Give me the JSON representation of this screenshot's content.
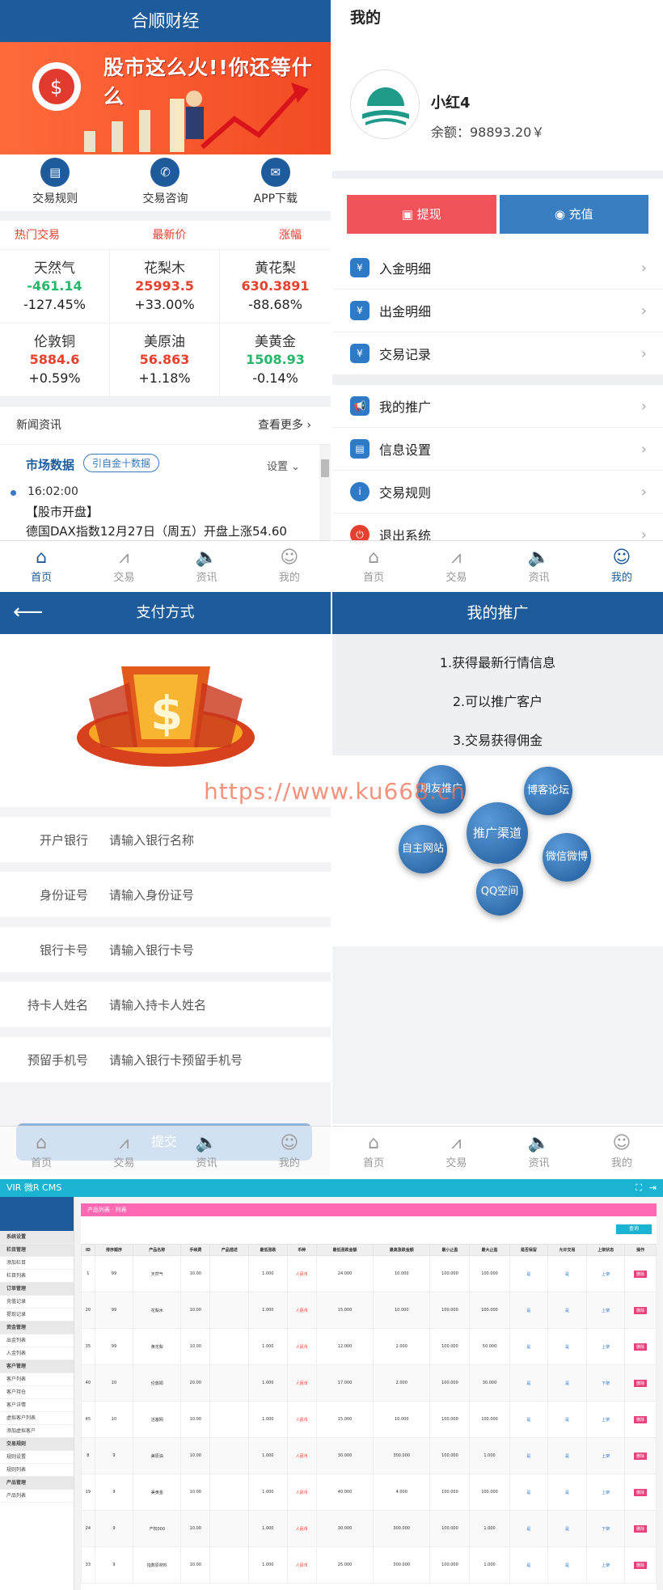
{
  "home": {
    "title": "合顺财经",
    "banner_text": "股市这么火!!你还等什么",
    "quick": [
      "交易规则",
      "交易咨询",
      "APP下载"
    ],
    "table_header": [
      "热门交易",
      "最新价",
      "涨幅"
    ],
    "quotes": [
      {
        "name": "天然气",
        "price": "-461.14",
        "change": "-127.45%",
        "dir": "down"
      },
      {
        "name": "花梨木",
        "price": "25993.5",
        "change": "+33.00%",
        "dir": "up"
      },
      {
        "name": "黄花梨",
        "price": "630.3891",
        "change": "-88.68%",
        "dir": "up"
      },
      {
        "name": "伦敦铜",
        "price": "5884.6",
        "change": "+0.59%",
        "dir": "up"
      },
      {
        "name": "美原油",
        "price": "56.863",
        "change": "+1.18%",
        "dir": "up"
      },
      {
        "name": "美黄金",
        "price": "1508.93",
        "change": "-0.14%",
        "dir": "down"
      }
    ],
    "news_label": "新闻资讯",
    "more_label": "查看更多 ›",
    "market_title": "市场数据",
    "market_badge": "引自金十数据",
    "market_setting": "设置 ⌄",
    "news_time": "16:02:00",
    "news_headline": "【股市开盘】",
    "news_text": "德国DAX指数12月27日（周五）开盘上涨54.60",
    "tabs": [
      "首页",
      "交易",
      "资讯",
      "我的"
    ]
  },
  "mine": {
    "title": "我的",
    "username": "小红4",
    "balance": "余额：98893.20￥",
    "withdraw": "提现",
    "recharge": "充值",
    "menu_group1": [
      "入金明细",
      "出金明细",
      "交易记录"
    ],
    "menu_group2": [
      "我的推广",
      "信息设置",
      "交易规则",
      "退出系统"
    ]
  },
  "pay": {
    "title": "支付方式",
    "fields": [
      {
        "label": "开户银行",
        "placeholder": "请输入银行名称"
      },
      {
        "label": "身份证号",
        "placeholder": "请输入身份证号"
      },
      {
        "label": "银行卡号",
        "placeholder": "请输入银行卡号"
      },
      {
        "label": "持卡人姓名",
        "placeholder": "请输入持卡人姓名"
      },
      {
        "label": "预留手机号",
        "placeholder": "请输入银行卡预留手机号"
      }
    ],
    "submit": "提交"
  },
  "promo": {
    "title": "我的推广",
    "points": [
      "1.获得最新行情信息",
      "2.可以推广客户",
      "3.交易获得佣金"
    ],
    "channels": [
      "朋友推广",
      "博客论坛",
      "推广渠道",
      "自主网站",
      "微信微博",
      "QQ空间"
    ]
  },
  "watermark": "https://www.ku668.cn",
  "admin": {
    "brand": "VIR 微R CMS",
    "panel_title": "产品列表 · 列表",
    "search_btn": "查询",
    "columns": [
      "ID",
      "排序顺序",
      "产品名称",
      "手续费",
      "产品描述",
      "最低涨跌",
      "币种",
      "最低涨跌金额",
      "最高涨跌金额",
      "最小止盈",
      "最大止盈",
      "是否保留",
      "允许交易",
      "上架状态",
      "操作"
    ],
    "rows": [
      [
        "1",
        "99",
        "天然气",
        "10.00",
        "人民币",
        "24.000",
        "10.000",
        "100.000",
        "上架"
      ],
      [
        "20",
        "99",
        "花梨木",
        "10.00",
        "人民币",
        "15.000",
        "10.000",
        "100.000",
        "上架"
      ],
      [
        "35",
        "99",
        "黄花梨",
        "10.00",
        "人民币",
        "12.000",
        "2.000",
        "50.000",
        "上架"
      ],
      [
        "40",
        "10",
        "伦敦铜",
        "20.00",
        "人民币",
        "17.000",
        "2.000",
        "30.000",
        "下架"
      ],
      [
        "45",
        "10",
        "活塞网",
        "10.00",
        "人民币",
        "15.000",
        "10.000",
        "100.000",
        "上架"
      ],
      [
        "8",
        "9",
        "美原油",
        "10.00",
        "人民币",
        "30.000",
        "300.000",
        "1.000",
        "上架"
      ],
      [
        "19",
        "9",
        "美黄金",
        "10.00",
        "人民币",
        "40.000",
        "4.000",
        "100.000",
        "上架"
      ],
      [
        "24",
        "9",
        "产权000",
        "10.00",
        "人民币",
        "30.000",
        "300.000",
        "1.000",
        "下架"
      ],
      [
        "33",
        "9",
        "指数原材料",
        "10.00",
        "人民币",
        "25.000",
        "300.000",
        "1.000",
        "上架"
      ]
    ],
    "side_items": [
      "系统设置",
      "栏目管理",
      "添加栏目",
      "栏目列表",
      "订单管理",
      "充值记录",
      "提现记录",
      "资金管理",
      "出金列表",
      "入金列表",
      "客户管理",
      "客户列表",
      "客户持仓",
      "客户详情",
      "虚拟客户列表",
      "添加虚拟客户",
      "交易规则",
      "规则设置",
      "规则列表",
      "产品管理",
      "产品列表"
    ],
    "delete": "删除"
  }
}
